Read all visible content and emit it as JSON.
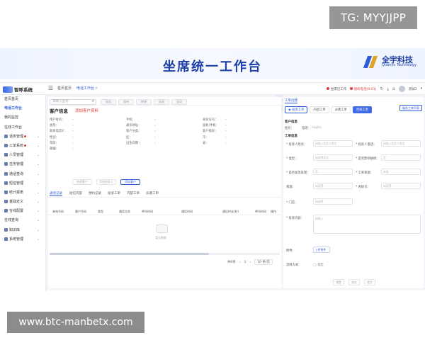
{
  "overlays": {
    "tg": "TG: MYYJJPP",
    "url": "www.btc-manbetx.com"
  },
  "banner": {
    "title": "坐席统一工作台",
    "brand_name": "全宇科技",
    "brand_en": "Quanyu Technology"
  },
  "watermark": {
    "text": "全宇科技"
  },
  "topbar": {
    "app_name": "智呼系统",
    "tabs": [
      {
        "label": "首页首页"
      },
      {
        "label": "电话工作台"
      }
    ],
    "right": {
      "status_label": "坐席已工作",
      "call_label": "接听电话(0:01)",
      "user": "测试2"
    }
  },
  "sidebar": {
    "items": [
      {
        "label": "首页首页"
      },
      {
        "label": "电话工作台"
      },
      {
        "label": "我的监控"
      },
      {
        "label": "在线工作台"
      },
      {
        "label": "话务管理"
      },
      {
        "label": "工单系统"
      },
      {
        "label": "人员管理"
      },
      {
        "label": "任务管理"
      },
      {
        "label": "通话查询"
      },
      {
        "label": "短信管理"
      },
      {
        "label": "统计报表"
      },
      {
        "label": "基础定义"
      },
      {
        "label": "在线配置"
      },
      {
        "label": "在线查询"
      },
      {
        "label": "知识库"
      },
      {
        "label": "系统管理"
      }
    ]
  },
  "main": {
    "search_placeholder": "请输入查询",
    "toolbar_buttons": [
      "挂机",
      "保持",
      "转接",
      "咨询",
      "会议"
    ],
    "section_title": "客户信息",
    "add_link": "添加客户资料",
    "info_rows": [
      [
        {
          "label": "用户姓名：",
          "value": "-"
        },
        {
          "label": "手机：",
          "value": "-"
        },
        {
          "label": "身份证号：",
          "value": "-"
        }
      ],
      [
        {
          "label": "类型：",
          "value": "-"
        },
        {
          "label": "通讯地址：",
          "value": "-"
        },
        {
          "label": "座机/手机：",
          "value": "-"
        }
      ],
      [
        {
          "label": "联系电话2：",
          "value": "-"
        },
        {
          "label": "客户分类：",
          "value": "-"
        },
        {
          "label": "客户级别：",
          "value": "-"
        }
      ],
      [
        {
          "label": "性别：",
          "value": "-"
        },
        {
          "label": "区：",
          "value": "-"
        },
        {
          "label": "市：",
          "value": "-"
        }
      ],
      [
        {
          "label": "年龄：",
          "value": "-"
        },
        {
          "label": "出生日期：",
          "value": "-"
        },
        {
          "label": "省：",
          "value": "-"
        }
      ],
      [
        {
          "label": "邮编：",
          "value": "-"
        }
      ]
    ],
    "info_buttons": [
      "修改客户",
      "添加联系人",
      "添加客户"
    ],
    "subtabs": [
      "通话记录",
      "短信内容",
      "预约记录",
      "投诉工单",
      "内部工单",
      "派遣工单"
    ],
    "table_headers": [
      "来电号码",
      "客户号码",
      "类型",
      "通话业务",
      "呼叫时间",
      "通话时间",
      "通话时长(秒)",
      "呼叫时间",
      "操作"
    ],
    "empty_text": "暂无数据",
    "pager": {
      "total": "共0条",
      "page": "1",
      "size": "10 条/页"
    }
  },
  "right_panel": {
    "tab": "工单创建",
    "top_button": "服务工单列表",
    "order_types": [
      "投诉工单",
      "内部工单",
      "派遣工单",
      "咨询工单"
    ],
    "customer_section": "客户信息",
    "customer_fields": [
      {
        "label": "姓名：",
        "value": ""
      },
      {
        "label": "电话：",
        "value": "Sagita"
      }
    ],
    "order_section": "工单信息",
    "form_fields": [
      {
        "label": "* 投诉人姓名：",
        "placeholder": "请输入投诉人姓名"
      },
      {
        "label": "* 投诉人电话：",
        "placeholder": "请输入投诉人电话"
      },
      {
        "label": "* 类型：",
        "placeholder": "请选择类型"
      },
      {
        "label": "* 是否影响维修：",
        "placeholder": "是"
      },
      {
        "label": "* 是否加急处理：",
        "placeholder": "否"
      },
      {
        "label": "* 工单来源：",
        "placeholder": "来电"
      },
      {
        "label": "来源：",
        "placeholder": "请选择"
      },
      {
        "label": "* 去除号：",
        "placeholder": "请选择"
      },
      {
        "label": "* 门店：",
        "placeholder": "请选择"
      },
      {
        "label": "* 投诉内容：",
        "placeholder": "请输入"
      },
      {
        "label": "附件：",
        "placeholder": "上传附件"
      },
      {
        "label": "流转方式：",
        "placeholder": "指定"
      }
    ],
    "bottom_buttons": [
      "重置",
      "保存",
      "提交"
    ]
  }
}
